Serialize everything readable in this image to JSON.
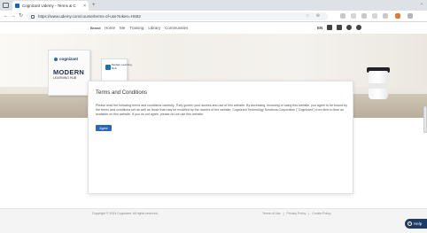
{
  "browser": {
    "tab_title": "Cognizant Udemy - Terms & C",
    "tab_close": "×",
    "new_tab": "+",
    "url": "https://www.udemy.com/course/terms-of-use?token=HS82",
    "nav": {
      "back": "←",
      "forward": "→",
      "reload": "↻"
    },
    "chevron": "⌄"
  },
  "site_nav": {
    "brand": "Brand",
    "menu": [
      "Home",
      "Me",
      "Training",
      "Library",
      "Communities"
    ],
    "lang": "EN"
  },
  "hero": {
    "book_logo": "cognizant",
    "book_title": "MODERN",
    "book_subtitle": "LEARNING HUB",
    "card_text_1": "Modern Learning",
    "card_text_2": "Hub"
  },
  "dialog": {
    "title": "Terms and Conditions",
    "body": "Please read the following terms and conditions carefully. They govern your access and use of this website. By accessing, browsing or using this website, you agree to be bound by the terms and conditions set as well as those that may be modified by the owners of the website, Cognizant Technology Solutions Corporation (\"Cognizant\") from time to time as available on this website. If you do not agree, please do not use this website.",
    "agree_label": "Agree"
  },
  "footer": {
    "copyright": "Copyright © 2024 Cognizant. All rights reserved.",
    "links": [
      "Terms of Use",
      "|",
      "Privacy Policy",
      "|",
      "Cookie Policy"
    ]
  },
  "help": {
    "label": "Help",
    "icon_glyph": "?"
  },
  "colors": {
    "primary": "#2a68b6",
    "help_bg": "#1e3a66"
  }
}
